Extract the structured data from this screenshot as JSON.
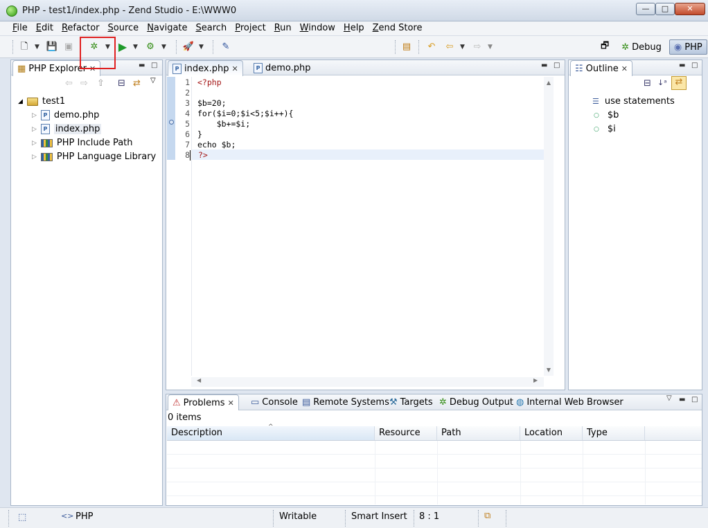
{
  "window": {
    "title": "PHP - test1/index.php - Zend Studio - E:\\WWW0",
    "min": "—",
    "max": "□",
    "close": "✕"
  },
  "menu": [
    "File",
    "Edit",
    "Refactor",
    "Source",
    "Navigate",
    "Search",
    "Project",
    "Run",
    "Window",
    "Help",
    "Zend Store"
  ],
  "perspectives": {
    "debug_label": "Debug",
    "php_label": "PHP"
  },
  "explorer": {
    "tab_label": "PHP Explorer",
    "project": "test1",
    "items": [
      "demo.php",
      "index.php",
      "PHP Include Path",
      "PHP Language Library"
    ]
  },
  "editor": {
    "tabs": [
      "index.php",
      "demo.php"
    ],
    "lines": [
      {
        "n": "1",
        "text": "<?php"
      },
      {
        "n": "2",
        "text": ""
      },
      {
        "n": "3",
        "text": "$b=20;"
      },
      {
        "n": "4",
        "text": "for($i=0;$i<5;$i++){"
      },
      {
        "n": "5",
        "text": "    $b+=$i;"
      },
      {
        "n": "6",
        "text": "}"
      },
      {
        "n": "7",
        "text": "echo $b;"
      },
      {
        "n": "8",
        "text": "?>"
      }
    ]
  },
  "outline": {
    "tab_label": "Outline",
    "items": [
      "use statements",
      "$b",
      "$i"
    ]
  },
  "bottom": {
    "tabs": [
      "Problems",
      "Console",
      "Remote Systems",
      "Targets",
      "Debug Output",
      "Internal Web Browser"
    ],
    "count": "0 items",
    "columns": [
      "Description",
      "Resource",
      "Path",
      "Location",
      "Type"
    ]
  },
  "status": {
    "lang": "PHP",
    "writable": "Writable",
    "insert": "Smart Insert",
    "position": "8 : 1"
  },
  "colors": {
    "highlight_box": "#e02020",
    "selection_bar": "#c5d8ef",
    "keyword": "#a31515"
  }
}
